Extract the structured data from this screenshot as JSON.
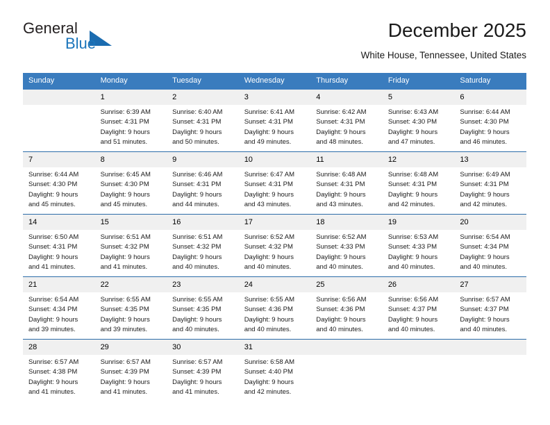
{
  "brand": {
    "word1": "General",
    "word2": "Blue",
    "triangle_color": "#1b6cb0",
    "blue_color": "#1b75bb"
  },
  "header": {
    "title": "December 2025",
    "subtitle": "White House, Tennessee, United States"
  },
  "theme": {
    "header_row_bg": "#3a7cbe",
    "daynum_bg": "#f0f0f0",
    "row_divider": "#2b6ca8"
  },
  "weekday_headers": [
    "Sunday",
    "Monday",
    "Tuesday",
    "Wednesday",
    "Thursday",
    "Friday",
    "Saturday"
  ],
  "weeks": [
    [
      {
        "day": "",
        "empty": true,
        "sunrise": "",
        "sunset": "",
        "daylight1": "",
        "daylight2": ""
      },
      {
        "day": "1",
        "sunrise": "Sunrise: 6:39 AM",
        "sunset": "Sunset: 4:31 PM",
        "daylight1": "Daylight: 9 hours",
        "daylight2": "and 51 minutes."
      },
      {
        "day": "2",
        "sunrise": "Sunrise: 6:40 AM",
        "sunset": "Sunset: 4:31 PM",
        "daylight1": "Daylight: 9 hours",
        "daylight2": "and 50 minutes."
      },
      {
        "day": "3",
        "sunrise": "Sunrise: 6:41 AM",
        "sunset": "Sunset: 4:31 PM",
        "daylight1": "Daylight: 9 hours",
        "daylight2": "and 49 minutes."
      },
      {
        "day": "4",
        "sunrise": "Sunrise: 6:42 AM",
        "sunset": "Sunset: 4:31 PM",
        "daylight1": "Daylight: 9 hours",
        "daylight2": "and 48 minutes."
      },
      {
        "day": "5",
        "sunrise": "Sunrise: 6:43 AM",
        "sunset": "Sunset: 4:30 PM",
        "daylight1": "Daylight: 9 hours",
        "daylight2": "and 47 minutes."
      },
      {
        "day": "6",
        "sunrise": "Sunrise: 6:44 AM",
        "sunset": "Sunset: 4:30 PM",
        "daylight1": "Daylight: 9 hours",
        "daylight2": "and 46 minutes."
      }
    ],
    [
      {
        "day": "7",
        "sunrise": "Sunrise: 6:44 AM",
        "sunset": "Sunset: 4:30 PM",
        "daylight1": "Daylight: 9 hours",
        "daylight2": "and 45 minutes."
      },
      {
        "day": "8",
        "sunrise": "Sunrise: 6:45 AM",
        "sunset": "Sunset: 4:30 PM",
        "daylight1": "Daylight: 9 hours",
        "daylight2": "and 45 minutes."
      },
      {
        "day": "9",
        "sunrise": "Sunrise: 6:46 AM",
        "sunset": "Sunset: 4:31 PM",
        "daylight1": "Daylight: 9 hours",
        "daylight2": "and 44 minutes."
      },
      {
        "day": "10",
        "sunrise": "Sunrise: 6:47 AM",
        "sunset": "Sunset: 4:31 PM",
        "daylight1": "Daylight: 9 hours",
        "daylight2": "and 43 minutes."
      },
      {
        "day": "11",
        "sunrise": "Sunrise: 6:48 AM",
        "sunset": "Sunset: 4:31 PM",
        "daylight1": "Daylight: 9 hours",
        "daylight2": "and 43 minutes."
      },
      {
        "day": "12",
        "sunrise": "Sunrise: 6:48 AM",
        "sunset": "Sunset: 4:31 PM",
        "daylight1": "Daylight: 9 hours",
        "daylight2": "and 42 minutes."
      },
      {
        "day": "13",
        "sunrise": "Sunrise: 6:49 AM",
        "sunset": "Sunset: 4:31 PM",
        "daylight1": "Daylight: 9 hours",
        "daylight2": "and 42 minutes."
      }
    ],
    [
      {
        "day": "14",
        "sunrise": "Sunrise: 6:50 AM",
        "sunset": "Sunset: 4:31 PM",
        "daylight1": "Daylight: 9 hours",
        "daylight2": "and 41 minutes."
      },
      {
        "day": "15",
        "sunrise": "Sunrise: 6:51 AM",
        "sunset": "Sunset: 4:32 PM",
        "daylight1": "Daylight: 9 hours",
        "daylight2": "and 41 minutes."
      },
      {
        "day": "16",
        "sunrise": "Sunrise: 6:51 AM",
        "sunset": "Sunset: 4:32 PM",
        "daylight1": "Daylight: 9 hours",
        "daylight2": "and 40 minutes."
      },
      {
        "day": "17",
        "sunrise": "Sunrise: 6:52 AM",
        "sunset": "Sunset: 4:32 PM",
        "daylight1": "Daylight: 9 hours",
        "daylight2": "and 40 minutes."
      },
      {
        "day": "18",
        "sunrise": "Sunrise: 6:52 AM",
        "sunset": "Sunset: 4:33 PM",
        "daylight1": "Daylight: 9 hours",
        "daylight2": "and 40 minutes."
      },
      {
        "day": "19",
        "sunrise": "Sunrise: 6:53 AM",
        "sunset": "Sunset: 4:33 PM",
        "daylight1": "Daylight: 9 hours",
        "daylight2": "and 40 minutes."
      },
      {
        "day": "20",
        "sunrise": "Sunrise: 6:54 AM",
        "sunset": "Sunset: 4:34 PM",
        "daylight1": "Daylight: 9 hours",
        "daylight2": "and 40 minutes."
      }
    ],
    [
      {
        "day": "21",
        "sunrise": "Sunrise: 6:54 AM",
        "sunset": "Sunset: 4:34 PM",
        "daylight1": "Daylight: 9 hours",
        "daylight2": "and 39 minutes."
      },
      {
        "day": "22",
        "sunrise": "Sunrise: 6:55 AM",
        "sunset": "Sunset: 4:35 PM",
        "daylight1": "Daylight: 9 hours",
        "daylight2": "and 39 minutes."
      },
      {
        "day": "23",
        "sunrise": "Sunrise: 6:55 AM",
        "sunset": "Sunset: 4:35 PM",
        "daylight1": "Daylight: 9 hours",
        "daylight2": "and 40 minutes."
      },
      {
        "day": "24",
        "sunrise": "Sunrise: 6:55 AM",
        "sunset": "Sunset: 4:36 PM",
        "daylight1": "Daylight: 9 hours",
        "daylight2": "and 40 minutes."
      },
      {
        "day": "25",
        "sunrise": "Sunrise: 6:56 AM",
        "sunset": "Sunset: 4:36 PM",
        "daylight1": "Daylight: 9 hours",
        "daylight2": "and 40 minutes."
      },
      {
        "day": "26",
        "sunrise": "Sunrise: 6:56 AM",
        "sunset": "Sunset: 4:37 PM",
        "daylight1": "Daylight: 9 hours",
        "daylight2": "and 40 minutes."
      },
      {
        "day": "27",
        "sunrise": "Sunrise: 6:57 AM",
        "sunset": "Sunset: 4:37 PM",
        "daylight1": "Daylight: 9 hours",
        "daylight2": "and 40 minutes."
      }
    ],
    [
      {
        "day": "28",
        "sunrise": "Sunrise: 6:57 AM",
        "sunset": "Sunset: 4:38 PM",
        "daylight1": "Daylight: 9 hours",
        "daylight2": "and 41 minutes."
      },
      {
        "day": "29",
        "sunrise": "Sunrise: 6:57 AM",
        "sunset": "Sunset: 4:39 PM",
        "daylight1": "Daylight: 9 hours",
        "daylight2": "and 41 minutes."
      },
      {
        "day": "30",
        "sunrise": "Sunrise: 6:57 AM",
        "sunset": "Sunset: 4:39 PM",
        "daylight1": "Daylight: 9 hours",
        "daylight2": "and 41 minutes."
      },
      {
        "day": "31",
        "sunrise": "Sunrise: 6:58 AM",
        "sunset": "Sunset: 4:40 PM",
        "daylight1": "Daylight: 9 hours",
        "daylight2": "and 42 minutes."
      },
      {
        "day": "",
        "empty": true,
        "sunrise": "",
        "sunset": "",
        "daylight1": "",
        "daylight2": ""
      },
      {
        "day": "",
        "empty": true,
        "sunrise": "",
        "sunset": "",
        "daylight1": "",
        "daylight2": ""
      },
      {
        "day": "",
        "empty": true,
        "sunrise": "",
        "sunset": "",
        "daylight1": "",
        "daylight2": ""
      }
    ]
  ]
}
